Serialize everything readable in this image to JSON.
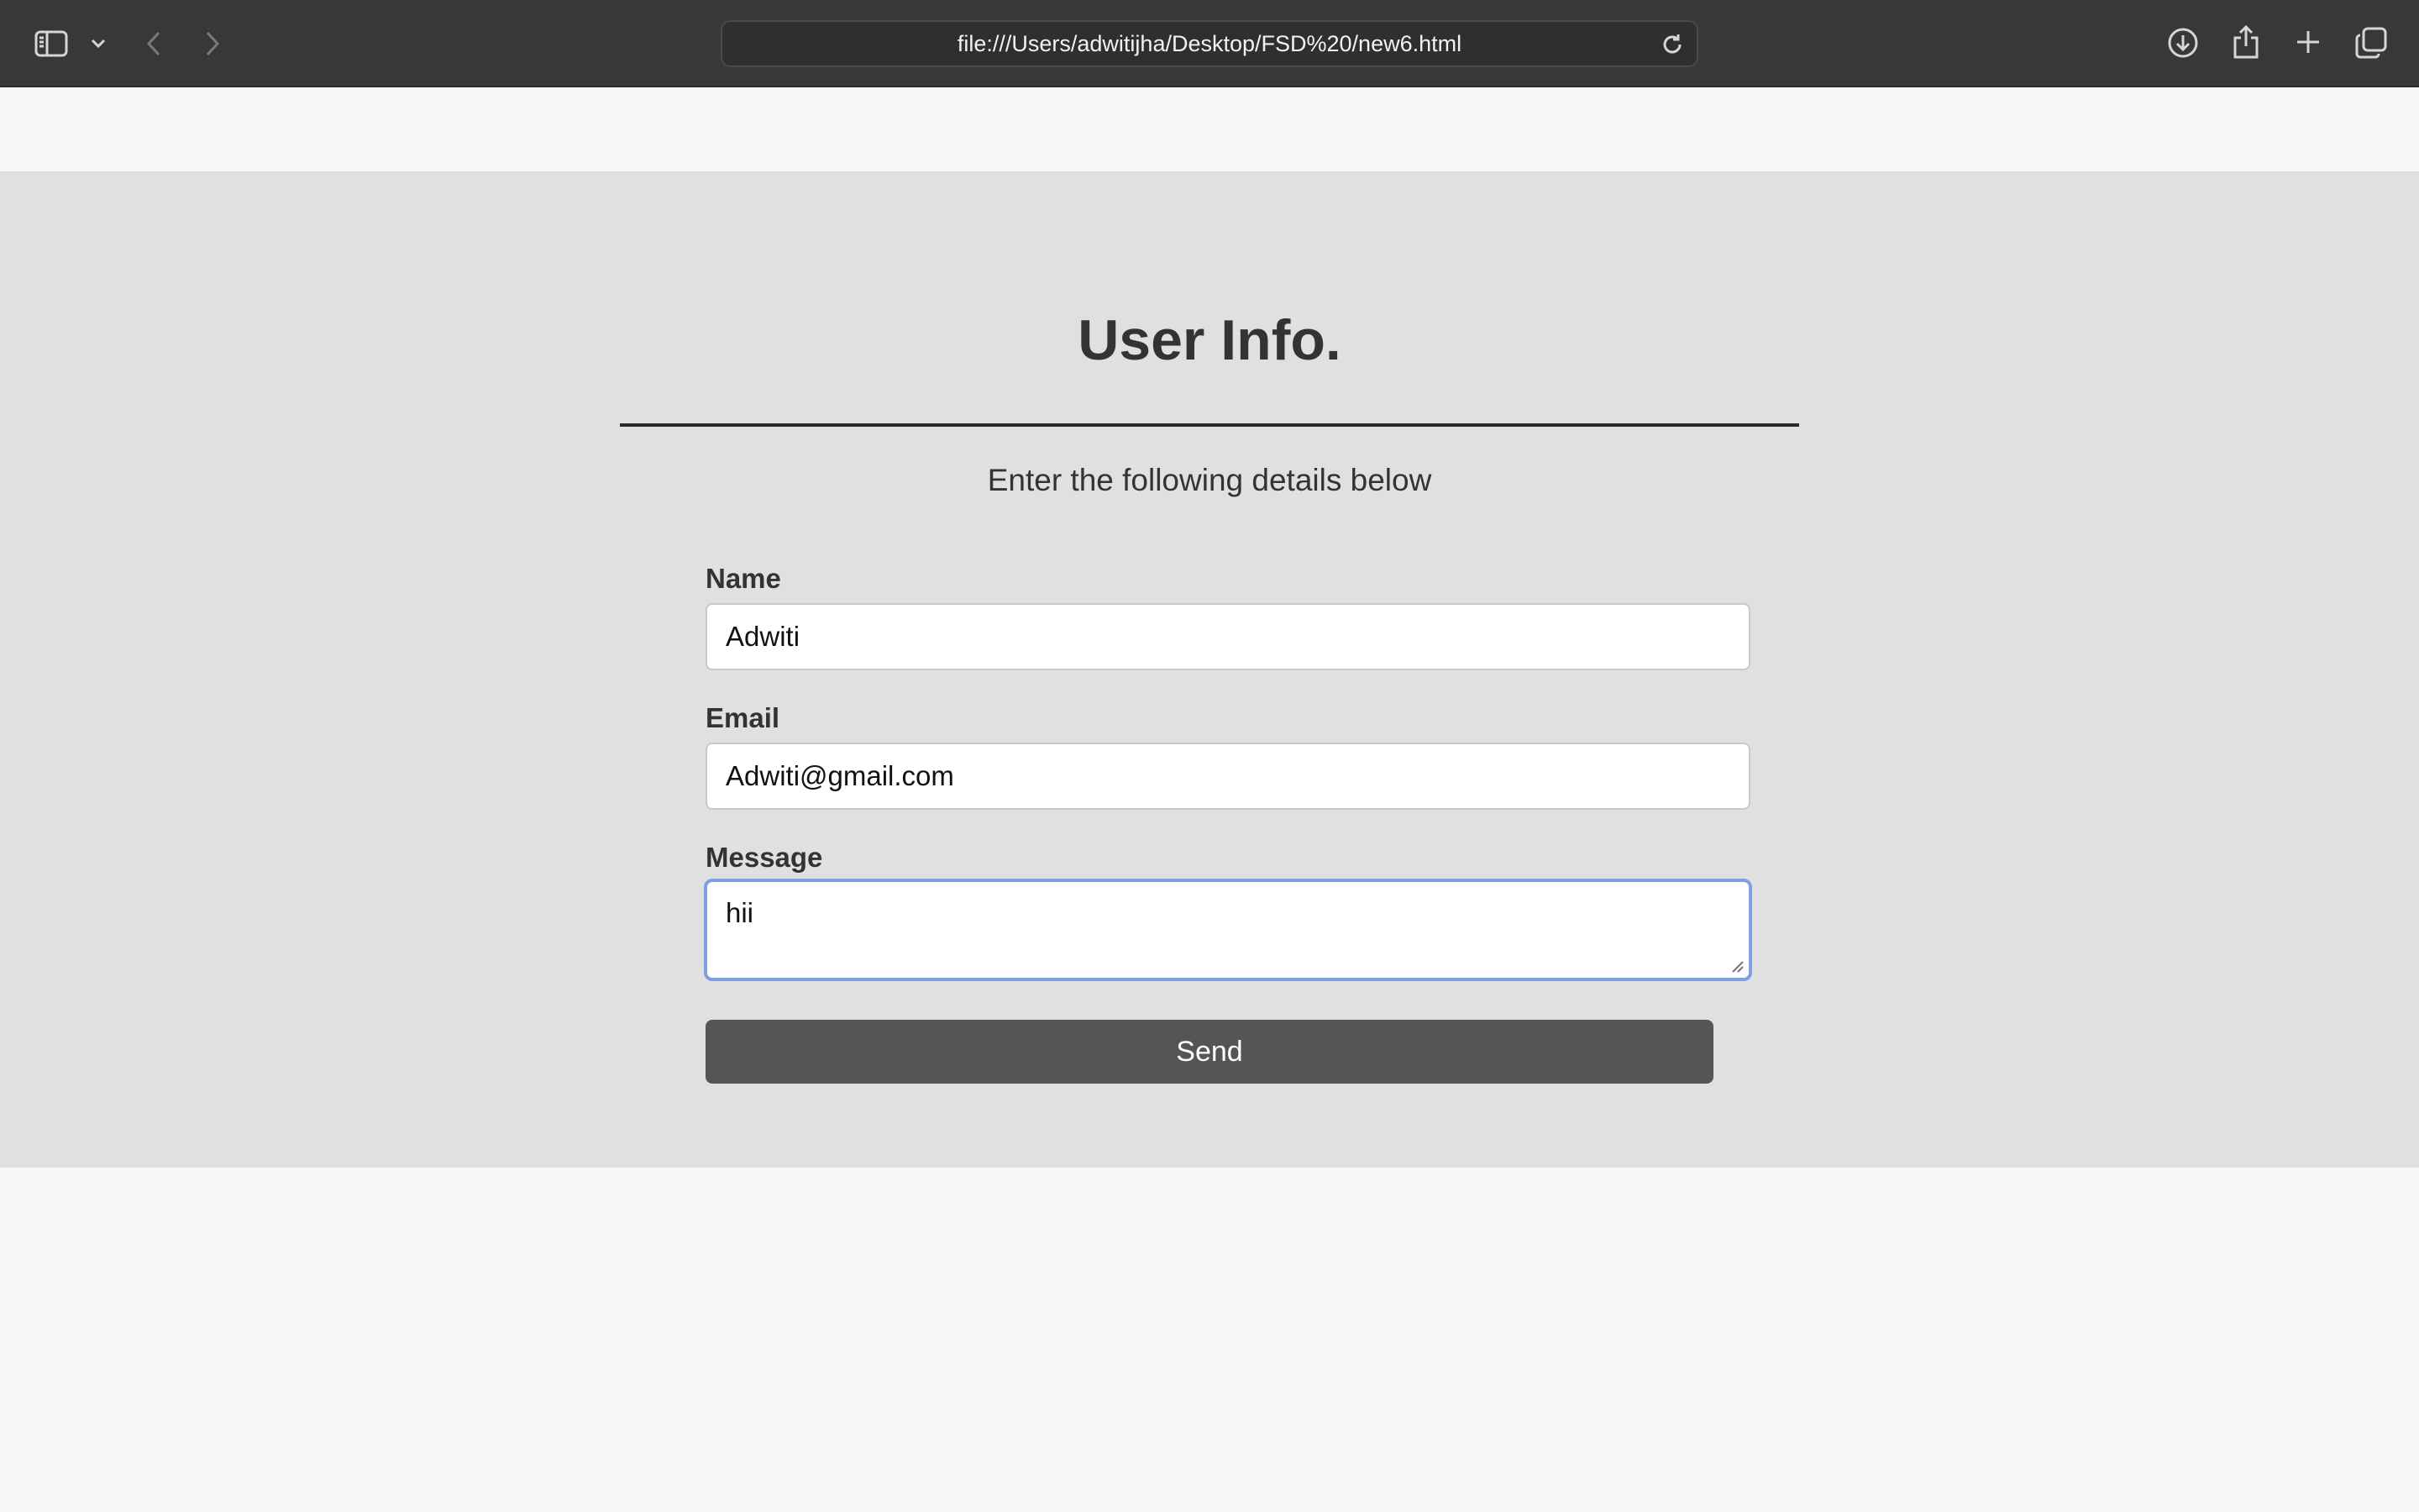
{
  "browser": {
    "url": "file:///Users/adwitijha/Desktop/FSD%20/new6.html",
    "icons": [
      "sidebar-icon",
      "chevron-down-icon",
      "back-icon",
      "forward-icon",
      "reload-icon",
      "download-icon",
      "share-icon",
      "new-tab-icon",
      "tabs-overview-icon"
    ]
  },
  "form": {
    "title": "User Info.",
    "subtitle": "Enter the following details below",
    "name_label": "Name",
    "name_value": "Adwiti",
    "email_label": "Email",
    "email_value": "Adwiti@gmail.com",
    "message_label": "Message",
    "message_value": "hii",
    "send_label": "Send"
  },
  "colors": {
    "toolbar": "#383838",
    "page_background": "#f7f7f7",
    "form_band": "#e0e0e0",
    "button": "#555555",
    "focus_ring": "#7e9fe0"
  }
}
